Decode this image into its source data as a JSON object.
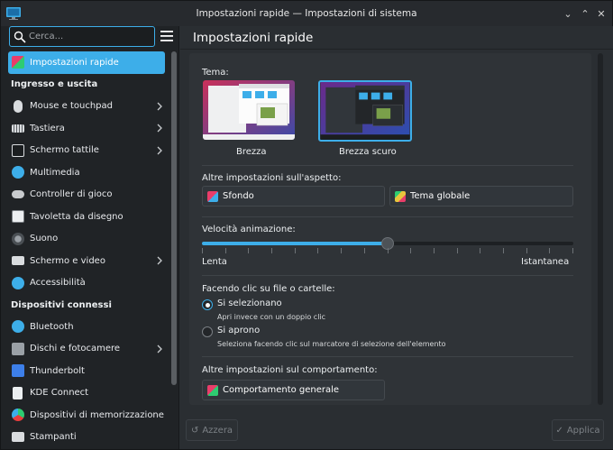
{
  "window": {
    "title": "Impostazioni rapide — Impostazioni di sistema"
  },
  "search": {
    "placeholder": "Cerca..."
  },
  "sidebar": {
    "active": {
      "label": "Impostazioni rapide"
    },
    "section_io": "Ingresso e uscita",
    "io_items": [
      {
        "label": "Mouse e touchpad",
        "icon": "mouse-icon"
      },
      {
        "label": "Tastiera",
        "icon": "keyboard-icon"
      },
      {
        "label": "Schermo tattile",
        "icon": "touchscreen-icon"
      },
      {
        "label": "Multimedia",
        "icon": "multimedia-icon"
      },
      {
        "label": "Controller di gioco",
        "icon": "gamepad-icon"
      },
      {
        "label": "Tavoletta da disegno",
        "icon": "tablet-icon"
      },
      {
        "label": "Suono",
        "icon": "speaker-icon"
      },
      {
        "label": "Schermo e video",
        "icon": "monitor-icon"
      },
      {
        "label": "Accessibilità",
        "icon": "accessibility-icon"
      }
    ],
    "section_devices": "Dispositivi connessi",
    "device_items": [
      {
        "label": "Bluetooth",
        "icon": "bluetooth-icon"
      },
      {
        "label": "Dischi e fotocamere",
        "icon": "disk-icon"
      },
      {
        "label": "Thunderbolt",
        "icon": "thunderbolt-icon"
      },
      {
        "label": "KDE Connect",
        "icon": "kde-connect-icon"
      },
      {
        "label": "Dispositivi di memorizzazione",
        "icon": "storage-icon"
      },
      {
        "label": "Stampanti",
        "icon": "printer-icon"
      }
    ]
  },
  "page": {
    "title": "Impostazioni rapide",
    "theme_label": "Tema:",
    "themes": [
      {
        "name": "Brezza",
        "selected": false
      },
      {
        "name": "Brezza scuro",
        "selected": true
      }
    ],
    "appearance_label": "Altre impostazioni sull'aspetto:",
    "wallpaper_button": "Sfondo",
    "global_theme_button": "Tema globale",
    "animation_label": "Velocità animazione:",
    "animation_min": "Lenta",
    "animation_max": "Istantanea",
    "animation_value": 0.5,
    "click_label": "Facendo clic su file o cartelle:",
    "click_options": [
      {
        "label": "Si selezionano",
        "description": "Apri invece con un doppio clic",
        "checked": true
      },
      {
        "label": "Si aprono",
        "description": "Seleziona facendo clic sul marcatore di selezione dell'elemento",
        "checked": false
      }
    ],
    "behavior_label": "Altre impostazioni sul comportamento:",
    "general_behavior_button": "Comportamento generale"
  },
  "footer": {
    "reset_label": "Azzera",
    "apply_label": "Applica"
  },
  "colors": {
    "accent": "#3daee9",
    "background": "#2a2e32",
    "sidebar": "#202326"
  }
}
